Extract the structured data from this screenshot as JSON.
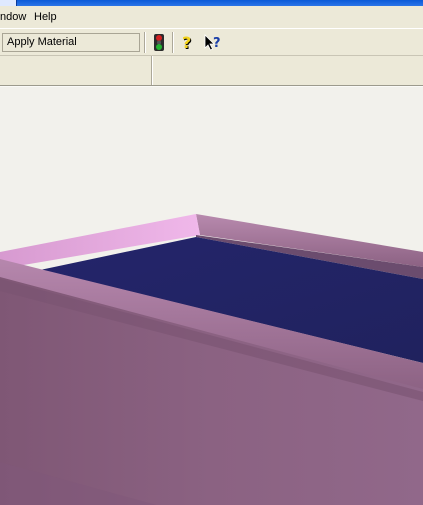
{
  "menubar": {
    "items": [
      {
        "label": "ndow"
      },
      {
        "label": "Help"
      }
    ]
  },
  "toolbar": {
    "status_text": "Apply Material",
    "buttons": [
      {
        "icon": "traffic-light-icon"
      },
      {
        "icon": "help-icon"
      },
      {
        "icon": "context-help-icon"
      }
    ]
  },
  "viewport": {
    "model": "tray",
    "colors": {
      "tray_outer": "#8a607f",
      "tray_rim": "#9c7094",
      "tray_rim_highlight": "#e6a8e0",
      "tray_inner_floor": "#232466",
      "background": "#f2f1ec"
    }
  }
}
